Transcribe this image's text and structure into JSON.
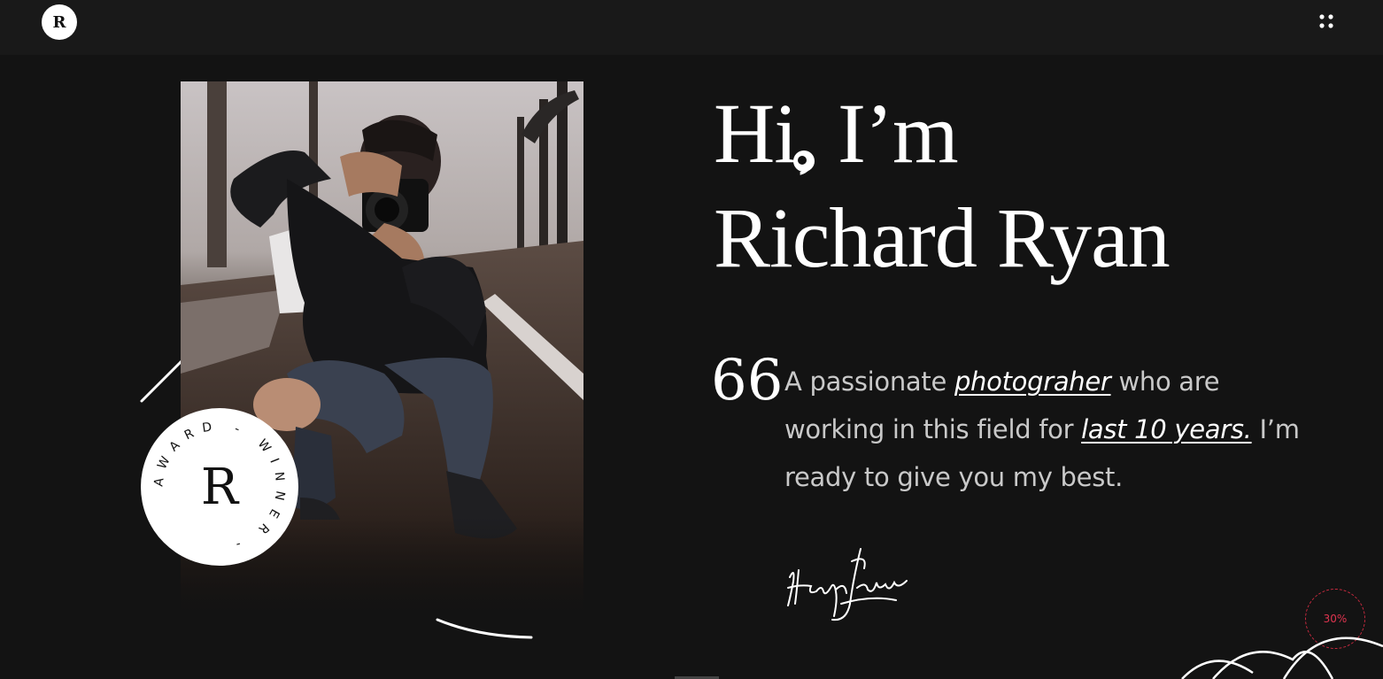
{
  "header": {
    "logo_letter": "R",
    "menu_icon": "dots-grid-icon"
  },
  "hero": {
    "greeting_line1": "Hi, I’m",
    "greeting_line2": "Richard Ryan",
    "quote_mark": "66",
    "bio_part1": "A passionate ",
    "bio_link1": "photograher",
    "bio_part2": " who are working in this field for ",
    "bio_link2": "last 10 years.",
    "bio_part3": " I’m ready to give you my best.",
    "signature_text": "Henry James"
  },
  "badge": {
    "ring_text": "AWARD - WINNER - ",
    "letter": "R"
  },
  "scroll_progress": {
    "label": "30%",
    "value": 0.3
  },
  "colors": {
    "background": "#131313",
    "header_background": "#191919",
    "accent": "#c62a3f"
  }
}
